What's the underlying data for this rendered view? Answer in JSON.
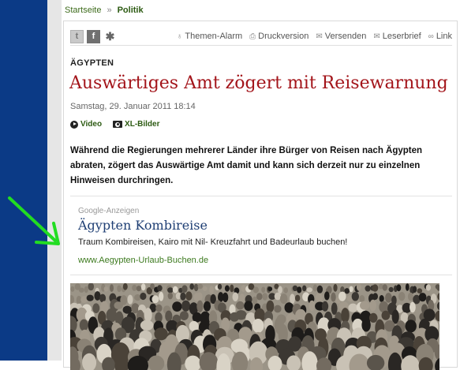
{
  "breadcrumb": {
    "home": "Startseite",
    "separator": "»",
    "current": "Politik"
  },
  "toolbar": {
    "share": [
      {
        "icon": "twitter-icon",
        "glyph": "t"
      },
      {
        "icon": "facebook-icon",
        "glyph": "f"
      },
      {
        "icon": "gear-icon",
        "glyph": "✱"
      }
    ],
    "actions": [
      {
        "label": "Themen-Alarm",
        "icon": "alarm-icon",
        "glyph": "♁"
      },
      {
        "label": "Druckversion",
        "icon": "print-icon",
        "glyph": "⎙"
      },
      {
        "label": "Versenden",
        "icon": "mail-icon",
        "glyph": "✉"
      },
      {
        "label": "Leserbrief",
        "icon": "letter-icon",
        "glyph": "✉"
      },
      {
        "label": "Link",
        "icon": "link-icon",
        "glyph": "∞"
      }
    ]
  },
  "article": {
    "kicker": "ÄGYPTEN",
    "headline": "Auswärtiges Amt zögert mit Reisewarnung",
    "date": "Samstag, 29. Januar 2011 18:14",
    "media": {
      "video": "Video",
      "pictures": "XL-Bilder"
    },
    "teaser": "Während die Regierungen mehrerer Länder ihre Bürger von Reisen nach Ägypten abraten, zögert das Auswärtige Amt damit und kann sich derzeit nur zu einzelnen Hinweisen durchringen."
  },
  "ad": {
    "label": "Google-Anzeigen",
    "title": "Ägypten Kombireise",
    "text": "Traum Kombireisen, Kairo mit Nil- Kreuzfahrt und Badeurlaub buchen!",
    "url": "www.Aegypten-Urlaub-Buchen.de"
  },
  "colors": {
    "rail": "#0b3a86",
    "headline": "#a3141a",
    "breadcrumb": "#3d6b1b",
    "ad_title": "#1f3f74",
    "ad_url": "#3d7a1f",
    "arrow": "#22dd22"
  }
}
